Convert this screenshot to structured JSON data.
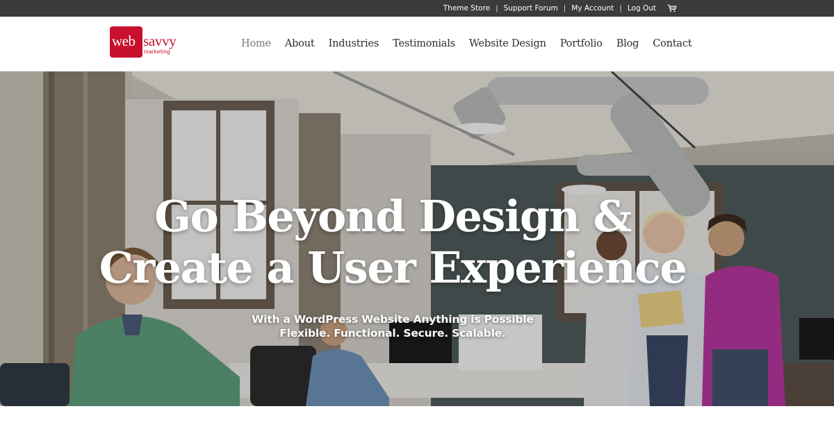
{
  "topbar": {
    "links": [
      "Theme Store",
      "Support Forum",
      "My Account",
      "Log Out"
    ],
    "separator": "|",
    "cart_icon": "shopping-cart-icon"
  },
  "logo": {
    "part1": "web",
    "part2": "savvy",
    "tagline": "marketing",
    "brand_color": "#c8102e"
  },
  "nav": {
    "items": [
      "Home",
      "About",
      "Industries",
      "Testimonials",
      "Website Design",
      "Portfolio",
      "Blog",
      "Contact"
    ],
    "active": "Home"
  },
  "hero": {
    "title_line1": "Go Beyond Design &",
    "title_line2": "Create a User Experience",
    "subtitle_line1": "With a WordPress Website Anything is Possible",
    "subtitle_line2": "Flexible. Functional. Secure. Scalable."
  }
}
